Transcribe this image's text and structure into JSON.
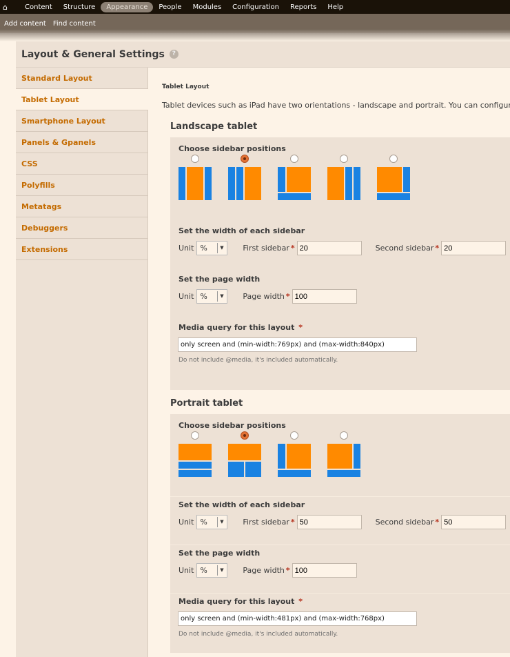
{
  "toolbar": {
    "items": [
      "Content",
      "Structure",
      "Appearance",
      "People",
      "Modules",
      "Configuration",
      "Reports",
      "Help"
    ],
    "active": "Appearance"
  },
  "shortcuts": [
    "Add content",
    "Find content"
  ],
  "page_title": "Layout & General Settings",
  "vtabs": [
    "Standard Layout",
    "Tablet Layout",
    "Smartphone Layout",
    "Panels & Gpanels",
    "CSS",
    "Polyfills",
    "Metatags",
    "Debuggers",
    "Extensions"
  ],
  "selected_tab": "Tablet Layout",
  "main": {
    "heading": "Tablet Layout",
    "description": "Tablet devices such as iPad have two orientations - landscape and portrait. You can configure a dif",
    "landscape": {
      "title": "Landscape tablet",
      "choose_label": "Choose sidebar positions",
      "layouts": [
        "three-col-grail",
        "two-sidebars-left",
        "one-sidebar-left-bottom",
        "two-sidebars-right",
        "one-sidebar-right-bottom"
      ],
      "selected_index": 1,
      "width_label": "Set the width of each sidebar",
      "unit_label": "Unit",
      "unit_value": "%",
      "first_label": "First sidebar",
      "first_value": "20",
      "second_label": "Second sidebar",
      "second_value": "20",
      "page_width_label": "Set the page width",
      "page_width_field": "Page width",
      "page_width_value": "100",
      "mq_label": "Media query for this layout",
      "mq_value": "only screen and (min-width:769px) and (max-width:840px)",
      "mq_note": "Do not include @media, it's included automatically."
    },
    "portrait": {
      "title": "Portrait tablet",
      "choose_label": "Choose sidebar positions",
      "layouts": [
        "one-col-stack",
        "one-col-vert",
        "one-sidebar-left-bottom",
        "one-sidebar-right-bottom"
      ],
      "selected_index": 1,
      "width_label": "Set the width of each sidebar",
      "unit_label": "Unit",
      "unit_value": "%",
      "first_label": "First sidebar",
      "first_value": "50",
      "second_label": "Second sidebar",
      "second_value": "50",
      "page_width_label": "Set the page width",
      "page_width_field": "Page width",
      "page_width_value": "100",
      "mq_label": "Media query for this layout",
      "mq_value": "only screen and (min-width:481px) and (max-width:768px)",
      "mq_note": "Do not include @media, it's included automatically."
    }
  },
  "required_marker": "*",
  "colors": {
    "accent": "#c46b00",
    "sidebar_block": "#1a82e2",
    "content_block": "#ff8a00"
  }
}
